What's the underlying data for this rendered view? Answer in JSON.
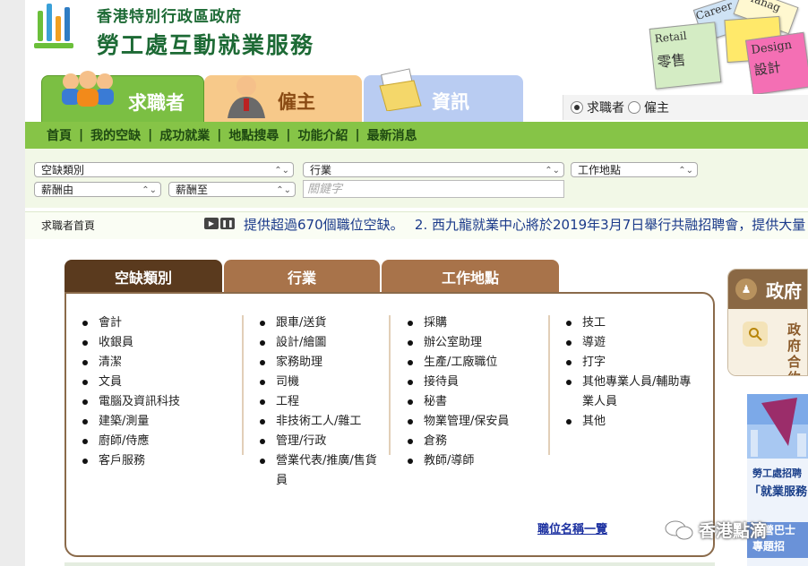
{
  "header": {
    "logo_line1": "香港特別行政區政府",
    "logo_line2": "勞工處互動就業服務",
    "banner_cards": [
      "Retail",
      "零售",
      "Design",
      "設計",
      "Manag",
      "Career"
    ]
  },
  "tabs": [
    {
      "label": "求職者",
      "color": "#7bbf43"
    },
    {
      "label": "僱主",
      "color": "#f7c98a"
    },
    {
      "label": "資訊",
      "color": "#b9ccf2"
    }
  ],
  "role_switch": {
    "options": [
      "求職者",
      "僱主"
    ],
    "selected": "求職者"
  },
  "nav": [
    "首頁",
    "我的空缺",
    "成功就業",
    "地點搜尋",
    "功能介紹",
    "最新消息"
  ],
  "search": {
    "category": "空缺類別",
    "industry": "行業",
    "location": "工作地點",
    "salary_from": "薪酬由",
    "salary_to": "薪酬至",
    "keyword_placeholder": "關鍵字"
  },
  "breadcrumb": "求職者首頁",
  "ticker": "提供超過670個職位空缺。　 2. 西九龍就業中心將於2019年3月7日舉行共融招聘會，提供大量",
  "panel": {
    "tabs": [
      "空缺類別",
      "行業",
      "工作地點"
    ],
    "columns": [
      [
        "會計",
        "收銀員",
        "清潔",
        "文員",
        "電腦及資訊科技",
        "建築/測量",
        "廚師/侍應",
        "客戶服務"
      ],
      [
        "跟車/送貨",
        "設計/繪圖",
        "家務助理",
        "司機",
        "工程",
        "非技術工人/雜工",
        "管理/行政",
        "營業代表/推廣/售貨員"
      ],
      [
        "採購",
        "辦公室助理",
        "生產/工廠職位",
        "接待員",
        "秘書",
        "物業管理/保安員",
        "倉務",
        "教師/導師"
      ],
      [
        "技工",
        "導遊",
        "打字",
        "其他專業人員/輔助專業人員",
        "其他"
      ]
    ],
    "all_link": "職位名稱一覽"
  },
  "side": {
    "title": "政府",
    "body_line1": "政府",
    "body_line2": "合約",
    "ad_line1": "勞工處招聘",
    "ad_line2": "「就業服務",
    "ad_line3": "專營巴士",
    "ad_line4": "專題招"
  },
  "watermark": "香港點滴"
}
